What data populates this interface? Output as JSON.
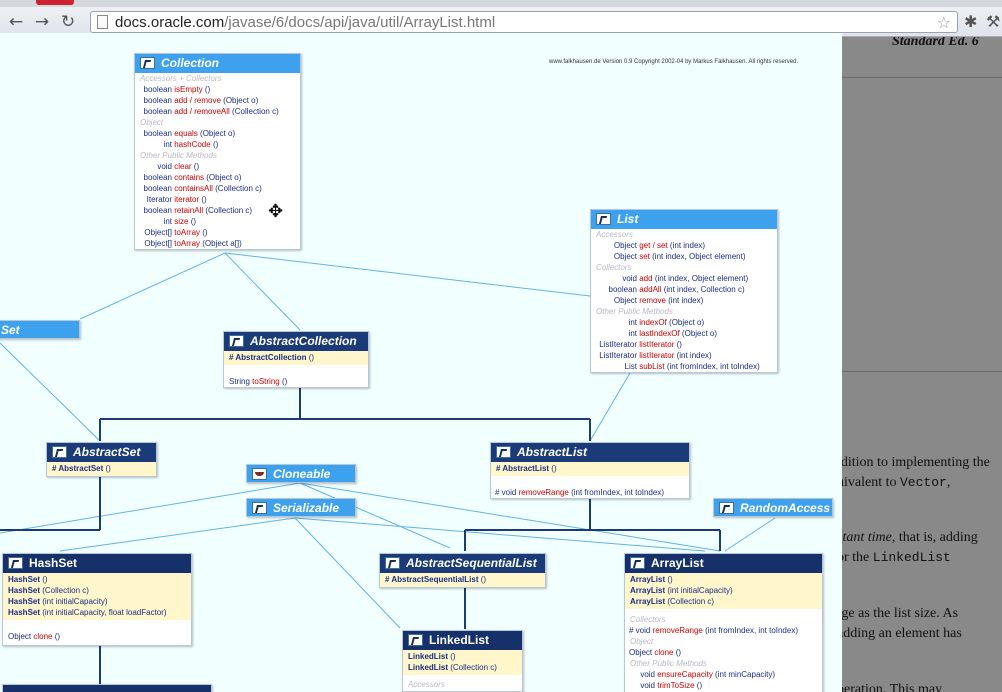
{
  "browser": {
    "url_host": "docs.oracle.com",
    "url_path": "/javase/6/docs/api/java/util/ArrayList.html",
    "back_icon": "arrow-left-icon",
    "forward_icon": "arrow-right-icon",
    "reload_icon": "reload-icon",
    "bookmark_icon": "star-icon",
    "extension_icon": "puzzle-icon",
    "menu_icon": "wrench-icon"
  },
  "docs": {
    "edition": "Standard Ed. 6",
    "lines": [
      {
        "text": "ldition to implementing the"
      },
      {
        "text": "uivalent to ",
        "code": "Vector",
        "after": ","
      },
      {
        "text": "stant time",
        "after": ", that is, adding"
      },
      {
        "text": "or the ",
        "code": "LinkedList"
      },
      {
        "text": "rge as the list size.  As"
      },
      {
        "text": "adding an element has"
      },
      {
        "text": "peration.  This may"
      }
    ]
  },
  "diagram": {
    "copyright": "www.falkhausen.de  Version 0.9  Copyright 2002-04 by Markus Falkhausen. All rights reserved.",
    "collection": {
      "title": "Collection",
      "sections": [
        {
          "label": "Accessors + Collectors",
          "rows": [
            {
              "type": "boolean",
              "method": "isEmpty",
              "params": " ()"
            },
            {
              "type": "boolean",
              "method": "add / remove",
              "params": " (Object o)"
            },
            {
              "type": "boolean",
              "method": "add / removeAll",
              "params": " (Collection c)"
            }
          ]
        },
        {
          "label": "Object",
          "rows": [
            {
              "type": "boolean",
              "method": "equals",
              "params": " (Object o)"
            },
            {
              "type": "int",
              "method": "hashCode",
              "params": " ()"
            }
          ]
        },
        {
          "label": "Other Public Methods",
          "rows": [
            {
              "type": "void",
              "method": "clear",
              "params": " ()"
            },
            {
              "type": "boolean",
              "method": "contains",
              "params": " (Object o)"
            },
            {
              "type": "boolean",
              "method": "containsAll",
              "params": " (Collection c)"
            },
            {
              "type": "Iterator",
              "method": "iterator",
              "params": " ()"
            },
            {
              "type": "boolean",
              "method": "retainAll",
              "params": " (Collection c)"
            },
            {
              "type": "int",
              "method": "size",
              "params": " ()"
            },
            {
              "type": "Object[]",
              "method": "toArray",
              "params": " ()"
            },
            {
              "type": "Object[]",
              "method": "toArray",
              "params": " (Object a[])"
            }
          ]
        }
      ]
    },
    "list": {
      "title": "List",
      "sections": [
        {
          "label": "Accessors",
          "rows": [
            {
              "type": "Object",
              "method": "get / set",
              "params": " (int index)"
            },
            {
              "type": "Object",
              "method": "set",
              "params": " (int index, Object element)"
            }
          ]
        },
        {
          "label": "Collectors",
          "rows": [
            {
              "type": "void",
              "method": "add",
              "params": " (int index, Object element)"
            },
            {
              "type": "boolean",
              "method": "addAll",
              "params": " (int index, Collection c)"
            },
            {
              "type": "Object",
              "method": "remove",
              "params": " (int index)"
            }
          ]
        },
        {
          "label": "Other Public Methods",
          "rows": [
            {
              "type": "int",
              "method": "indexOf",
              "params": " (Object o)"
            },
            {
              "type": "int",
              "method": "lastIndexOf",
              "params": " (Object o)"
            },
            {
              "type": "ListIterator",
              "method": "listIterator",
              "params": " ()"
            },
            {
              "type": "ListIterator",
              "method": "listIterator",
              "params": " (int index)"
            },
            {
              "type": "List",
              "method": "subList",
              "params": " (int fromIndex, int toIndex)"
            }
          ]
        }
      ]
    },
    "set": {
      "title": "Set"
    },
    "abstract_collection": {
      "title": "AbstractCollection",
      "ctor_prefix": "# ",
      "ctor": "AbstractCollection",
      "ctor_params": " ()",
      "row": {
        "type": "String",
        "method": "toString",
        "params": " ()"
      }
    },
    "abstract_set": {
      "title": "AbstractSet",
      "ctor_prefix": "# ",
      "ctor": "AbstractSet",
      "ctor_params": " ()"
    },
    "abstract_list": {
      "title": "AbstractList",
      "ctor_prefix": "# ",
      "ctor": "AbstractList",
      "ctor_params": " ()",
      "row": {
        "type": "# void",
        "method": "removeRange",
        "params": " (int fromIndex, int toIndex)"
      }
    },
    "cloneable": "Cloneable",
    "serializable": "Serializable",
    "random_access": "RandomAccess",
    "hash_set": {
      "title": "HashSet",
      "ctors": [
        {
          "name": "HashSet",
          "params": " ()"
        },
        {
          "name": "HashSet",
          "params": " (Collection c)"
        },
        {
          "name": "HashSet",
          "params": " (int initialCapacity)"
        },
        {
          "name": "HashSet",
          "params": " (int initialCapacity, float loadFactor)"
        }
      ],
      "row": {
        "type": "Object",
        "method": "clone",
        "params": " ()"
      }
    },
    "abstract_sequential_list": {
      "title": "AbstractSequentialList",
      "ctor_prefix": "# ",
      "ctor": "AbstractSequentialList",
      "ctor_params": " ()"
    },
    "linked_list": {
      "title": "LinkedList",
      "ctors": [
        {
          "name": "LinkedList",
          "params": " ()"
        },
        {
          "name": "LinkedList",
          "params": " (Collection c)"
        }
      ],
      "section": "Accessors"
    },
    "array_list": {
      "title": "ArrayList",
      "ctors": [
        {
          "name": "ArrayList",
          "params": " ()"
        },
        {
          "name": "ArrayList",
          "params": " (int initialCapacity)"
        },
        {
          "name": "ArrayList",
          "params": " (Collection c)"
        }
      ],
      "sections": [
        {
          "label": "Collectors",
          "rows": [
            {
              "type": "# void",
              "method": "removeRange",
              "params": " (int fromIndex, int toIndex)"
            }
          ]
        },
        {
          "label": "Object",
          "rows": [
            {
              "type": "Object",
              "method": "clone",
              "params": " ()"
            }
          ]
        },
        {
          "label": "Other Public Methods",
          "rows": [
            {
              "type": "void",
              "method": "ensureCapacity",
              "params": " (int minCapacity)"
            },
            {
              "type": "void",
              "method": "trimToSize",
              "params": " ()"
            }
          ]
        }
      ]
    }
  }
}
